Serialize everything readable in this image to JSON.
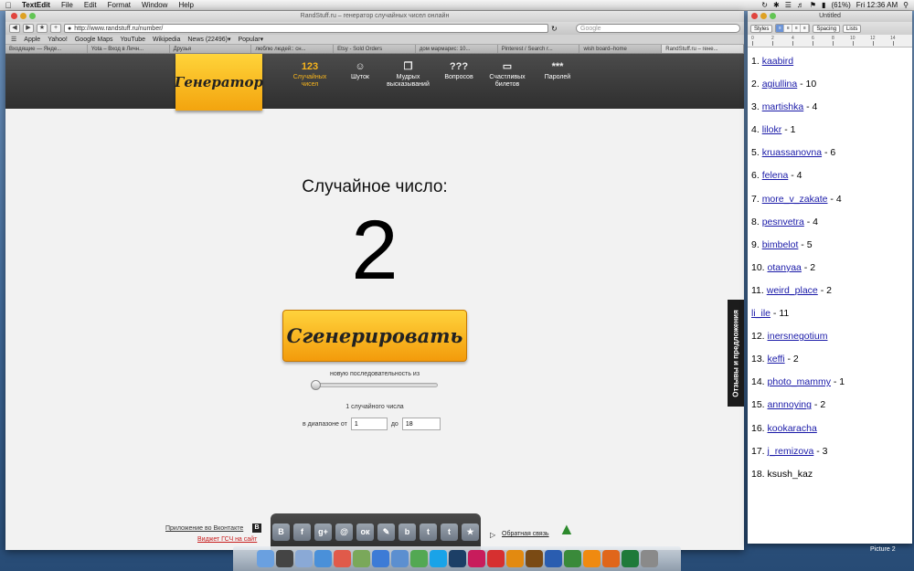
{
  "menubar": {
    "app_name": "TextEdit",
    "items": [
      "File",
      "Edit",
      "Format",
      "Window",
      "Help"
    ],
    "battery": "(61%)",
    "clock": "Fri 12:36 AM"
  },
  "browser": {
    "title": "RandStuff.ru – генератор случайных чисел онлайн",
    "url": "http://www.randstuff.ru/number/",
    "search_placeholder": "Google",
    "bookmarks": [
      "Apple",
      "Yahoo!",
      "Google Maps",
      "YouTube",
      "Wikipedia",
      "News (22496)▾",
      "Popular▾"
    ],
    "tabs": [
      "Входящие — Янде...",
      "Yota – Вход в Личн...",
      "Друзья",
      "люблю людей:: сн...",
      "Etsy - Sold Orders",
      "дом мармарис: 10...",
      "Pinterest / Search r...",
      "wish board–home",
      "RandStuff.ru – гене..."
    ]
  },
  "site": {
    "logo": "Генератор",
    "nav": [
      {
        "icon": "123",
        "label": "Случайных чисел"
      },
      {
        "icon": "☺",
        "label": "Шуток"
      },
      {
        "icon": "❐",
        "label": "Мудрых высказываний"
      },
      {
        "icon": "???",
        "label": "Вопросов"
      },
      {
        "icon": "▭",
        "label": "Счастливых билетов"
      },
      {
        "icon": "***",
        "label": "Паролей"
      }
    ],
    "heading": "Случайное число:",
    "number": "2",
    "generate_label": "Сгенерировать",
    "sequence_label": "новую последовательность из",
    "sequence_count": "1 случайного числа",
    "range_from_label": "в диапазоне от",
    "range_from": "1",
    "range_to_label": "до",
    "range_to": "18",
    "vk_app": "Приложение во Вконтакте",
    "vk_badge": "В",
    "widget": "Виджет ГСЧ на сайт",
    "feedback": "Обратная связь",
    "side_tab": "Отзывы и предложения",
    "social": [
      "В",
      "f",
      "g+",
      "@",
      "ок",
      "✎",
      "b",
      "t",
      "t",
      "★"
    ]
  },
  "textedit": {
    "title": "Untitled",
    "styles": "Styles",
    "spacing": "Spacing",
    "lists": "Lists",
    "ruler": [
      "0",
      "2",
      "4",
      "6",
      "8",
      "10",
      "12",
      "14"
    ],
    "list": [
      {
        "num": "1. ",
        "name": "kaabird",
        "link": true,
        "suffix": ""
      },
      {
        "num": "2. ",
        "name": "agiullina",
        "link": true,
        "suffix": " - 10"
      },
      {
        "num": "3. ",
        "name": "martishka",
        "link": true,
        "suffix": " - 4"
      },
      {
        "num": "4. ",
        "name": "lilokr",
        "link": true,
        "suffix": " - 1"
      },
      {
        "num": "5. ",
        "name": "kruassanovna",
        "link": true,
        "suffix": " - 6"
      },
      {
        "num": "6. ",
        "name": "felena",
        "link": true,
        "suffix": " - 4"
      },
      {
        "num": "7. ",
        "name": "more_v_zakate",
        "link": true,
        "suffix": " - 4"
      },
      {
        "num": "8. ",
        "name": "pesnvetra",
        "link": true,
        "suffix": " - 4"
      },
      {
        "num": "9. ",
        "name": "bimbelot",
        "link": true,
        "suffix": " - 5"
      },
      {
        "num": "10. ",
        "name": "otanyaa",
        "link": true,
        "suffix": " - 2"
      },
      {
        "num": "11. ",
        "name": "weird_place",
        "link": true,
        "suffix": " - 2"
      },
      {
        "num": "",
        "name": "li_ile",
        "link": true,
        "suffix": " - 11"
      },
      {
        "num": "12. ",
        "name": "inersnegotium",
        "link": true,
        "suffix": ""
      },
      {
        "num": "13. ",
        "name": "keffi",
        "link": true,
        "suffix": " - 2"
      },
      {
        "num": "14. ",
        "name": "photo_mammy",
        "link": true,
        "suffix": " - 1"
      },
      {
        "num": "15. ",
        "name": "annnoying",
        "link": true,
        "suffix": " - 2"
      },
      {
        "num": "16. ",
        "name": "kookaracha",
        "link": true,
        "suffix": ""
      },
      {
        "num": "17. ",
        "name": "j_remizova",
        "link": true,
        "suffix": " - 3"
      },
      {
        "num": "18. ",
        "name": "ksush_kaz",
        "link": false,
        "suffix": ""
      }
    ]
  },
  "dock": {
    "items": [
      "finder",
      "dashboard",
      "mail",
      "safari",
      "ical",
      "preview",
      "itunes",
      "iphoto",
      "facetime",
      "skype",
      "photoshop",
      "indesign",
      "acrobat",
      "illustrator",
      "bridge",
      "word",
      "utorrent",
      "vlc",
      "firefox",
      "excel",
      "trash"
    ],
    "screenshot_label": "Picture 2"
  },
  "colors": {
    "accent": "#f7b41c",
    "nav_bg": "#3a3a3a",
    "link": "#1a1aa8",
    "widget_red": "#c81c1c"
  }
}
